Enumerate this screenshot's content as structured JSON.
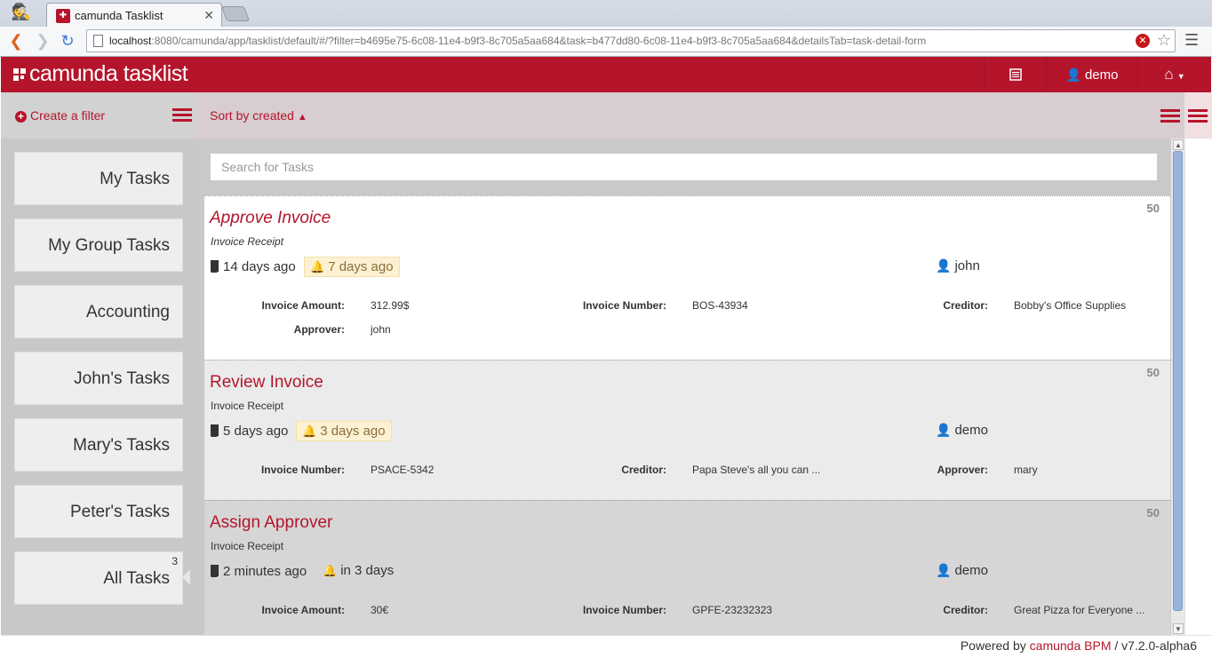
{
  "browser": {
    "tab_title": "camunda Tasklist",
    "url_host": "localhost",
    "url_rest": ":8080/camunda/app/tasklist/default/#/?filter=b4695e75-6c08-11e4-b9f3-8c705a5aa684&task=b477dd80-6c08-11e4-b9f3-8c705a5aa684&detailsTab=task-detail-form"
  },
  "header": {
    "brand": "camunda tasklist",
    "user": "demo"
  },
  "filters_panel": {
    "create_label": "Create a filter",
    "filters": [
      {
        "label": "My Tasks",
        "count": ""
      },
      {
        "label": "My Group Tasks",
        "count": ""
      },
      {
        "label": "Accounting",
        "count": ""
      },
      {
        "label": "John's Tasks",
        "count": ""
      },
      {
        "label": "Mary's Tasks",
        "count": ""
      },
      {
        "label": "Peter's Tasks",
        "count": ""
      },
      {
        "label": "All Tasks",
        "count": "3"
      }
    ]
  },
  "list": {
    "sort_label": "Sort by created",
    "search_placeholder": "Search for Tasks",
    "tasks": [
      {
        "name": "Approve Invoice",
        "process": "Invoice Receipt",
        "priority": "50",
        "created": "14 days ago",
        "due": "7 days ago",
        "assignee": "john",
        "vars": [
          {
            "k": "Invoice Amount:",
            "v": "312.99$"
          },
          {
            "k": "Invoice Number:",
            "v": "BOS-43934"
          },
          {
            "k": "Creditor:",
            "v": "Bobby's Office Supplies"
          },
          {
            "k": "Approver:",
            "v": "john"
          }
        ]
      },
      {
        "name": "Review Invoice",
        "process": "Invoice Receipt",
        "priority": "50",
        "created": "5 days ago",
        "due": "3 days ago",
        "assignee": "demo",
        "vars": [
          {
            "k": "Invoice Number:",
            "v": "PSACE-5342"
          },
          {
            "k": "Creditor:",
            "v": "Papa Steve's all you can ..."
          },
          {
            "k": "Approver:",
            "v": "mary"
          }
        ]
      },
      {
        "name": "Assign Approver",
        "process": "Invoice Receipt",
        "priority": "50",
        "created": "2 minutes ago",
        "due": "in 3 days",
        "assignee": "demo",
        "vars": [
          {
            "k": "Invoice Amount:",
            "v": "30€"
          },
          {
            "k": "Invoice Number:",
            "v": "GPFE-23232323"
          },
          {
            "k": "Creditor:",
            "v": "Great Pizza for Everyone ..."
          }
        ]
      }
    ]
  },
  "footer": {
    "prefix": "Powered by",
    "link": "camunda BPM",
    "version": "/ v7.2.0-alpha6"
  }
}
